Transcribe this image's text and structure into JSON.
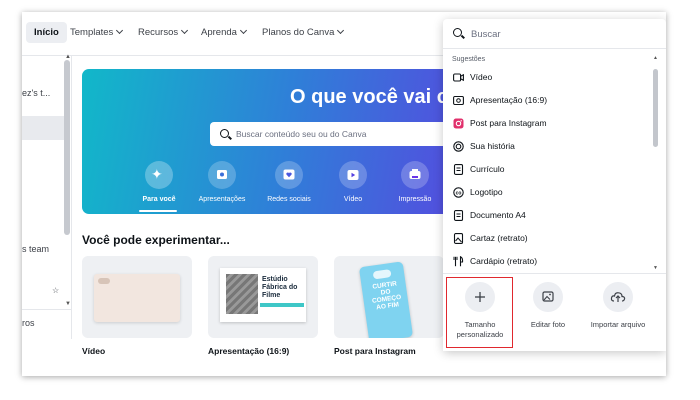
{
  "nav": {
    "items": [
      {
        "label": "Início",
        "active": true
      },
      {
        "label": "Templates"
      },
      {
        "label": "Recursos"
      },
      {
        "label": "Aprenda"
      },
      {
        "label": "Planos do Canva"
      }
    ]
  },
  "sidebar": {
    "team_name": "ez's t...",
    "team_item": "s team",
    "bottom_item": "ros"
  },
  "hero": {
    "title": "O que você vai cr",
    "search_placeholder": "Buscar conteúdo seu ou do Canva",
    "categories": [
      {
        "label": "Para você",
        "icon": "sparkle-icon",
        "selected": true
      },
      {
        "label": "Apresentações",
        "icon": "presentation-icon"
      },
      {
        "label": "Redes sociais",
        "icon": "heart-icon"
      },
      {
        "label": "Vídeo",
        "icon": "video-icon"
      },
      {
        "label": "Impressão",
        "icon": "printer-icon"
      }
    ],
    "gradient": [
      "#11b8c9",
      "#2f7fd8",
      "#5a45e0",
      "#7b2ff0"
    ]
  },
  "section": {
    "title": "Você pode experimentar...",
    "cards": [
      {
        "label": "Vídeo"
      },
      {
        "label": "Apresentação (16:9)",
        "thumb_text": "Estúdio Fábrica do Filme"
      },
      {
        "label": "Post para Instagram",
        "thumb_text": "CURTIR DO COMEÇO AO FIM"
      }
    ]
  },
  "dropdown": {
    "search_placeholder": "Buscar",
    "heading": "Sugestões",
    "suggestions": [
      {
        "label": "Vídeo",
        "icon": "video-icon"
      },
      {
        "label": "Apresentação (16:9)",
        "icon": "presentation-icon"
      },
      {
        "label": "Post para Instagram",
        "icon": "instagram-icon"
      },
      {
        "label": "Sua história",
        "icon": "story-icon"
      },
      {
        "label": "Currículo",
        "icon": "document-icon"
      },
      {
        "label": "Logotipo",
        "icon": "logo-icon"
      },
      {
        "label": "Documento A4",
        "icon": "document-icon"
      },
      {
        "label": "Cartaz (retrato)",
        "icon": "poster-icon"
      },
      {
        "label": "Cardápio (retrato)",
        "icon": "menu-icon"
      }
    ],
    "quick_actions": [
      {
        "label": "Tamanho personalizado",
        "icon": "plus-icon",
        "highlighted": true
      },
      {
        "label": "Editar foto",
        "icon": "image-edit-icon"
      },
      {
        "label": "Importar arquivo",
        "icon": "upload-cloud-icon"
      }
    ],
    "highlight_color": "#e0282e"
  },
  "colors": {
    "accent": "#7b2ff0",
    "instagram": "#e1306c"
  }
}
